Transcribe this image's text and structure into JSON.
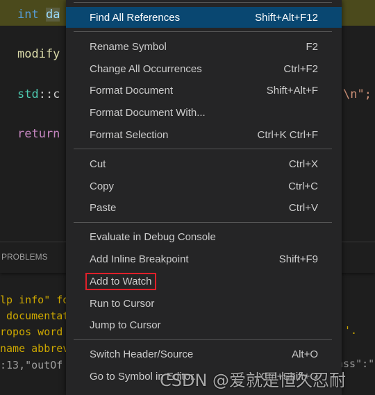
{
  "editor": {
    "lines": [
      {
        "parts": [
          {
            "t": "int ",
            "c": "#569cd6"
          },
          {
            "t": "da",
            "c": "#9cdcfe"
          }
        ]
      },
      {
        "parts": [
          {
            "t": "modify",
            "c": "#dcdcaa"
          }
        ]
      },
      {
        "parts": [
          {
            "t": "std",
            "c": "#4ec9b0"
          },
          {
            "t": "::c",
            "c": "#cccccc"
          }
        ]
      },
      {
        "parts": [
          {
            "t": "return",
            "c": "#c586c0"
          }
        ]
      }
    ],
    "tail": "\\n\";"
  },
  "panel": {
    "tab": "PROBLEMS",
    "lines": [
      "lp info\" fo",
      " documentat",
      "ropos word",
      "name abbrev",
      ":13,\"outOf"
    ],
    "tail1": "'.",
    "tail2": "ass\":\""
  },
  "menu": {
    "items": [
      {
        "label": "Find All References",
        "shortcut": "Shift+Alt+F12"
      },
      {
        "label": "Rename Symbol",
        "shortcut": "F2"
      },
      {
        "label": "Change All Occurrences",
        "shortcut": "Ctrl+F2"
      },
      {
        "label": "Format Document",
        "shortcut": "Shift+Alt+F"
      },
      {
        "label": "Format Document With...",
        "shortcut": ""
      },
      {
        "label": "Format Selection",
        "shortcut": "Ctrl+K Ctrl+F"
      },
      {
        "label": "Cut",
        "shortcut": "Ctrl+X"
      },
      {
        "label": "Copy",
        "shortcut": "Ctrl+C"
      },
      {
        "label": "Paste",
        "shortcut": "Ctrl+V"
      },
      {
        "label": "Evaluate in Debug Console",
        "shortcut": ""
      },
      {
        "label": "Add Inline Breakpoint",
        "shortcut": "Shift+F9"
      },
      {
        "label": "Add to Watch",
        "shortcut": ""
      },
      {
        "label": "Run to Cursor",
        "shortcut": ""
      },
      {
        "label": "Jump to Cursor",
        "shortcut": ""
      },
      {
        "label": "Switch Header/Source",
        "shortcut": "Alt+O"
      },
      {
        "label": "Go to Symbol in Editor...",
        "shortcut": "Ctrl+Shift+O"
      }
    ],
    "highlight_color": "#e0202a"
  },
  "watermark": "CSDN @爱就是恒久忍耐"
}
